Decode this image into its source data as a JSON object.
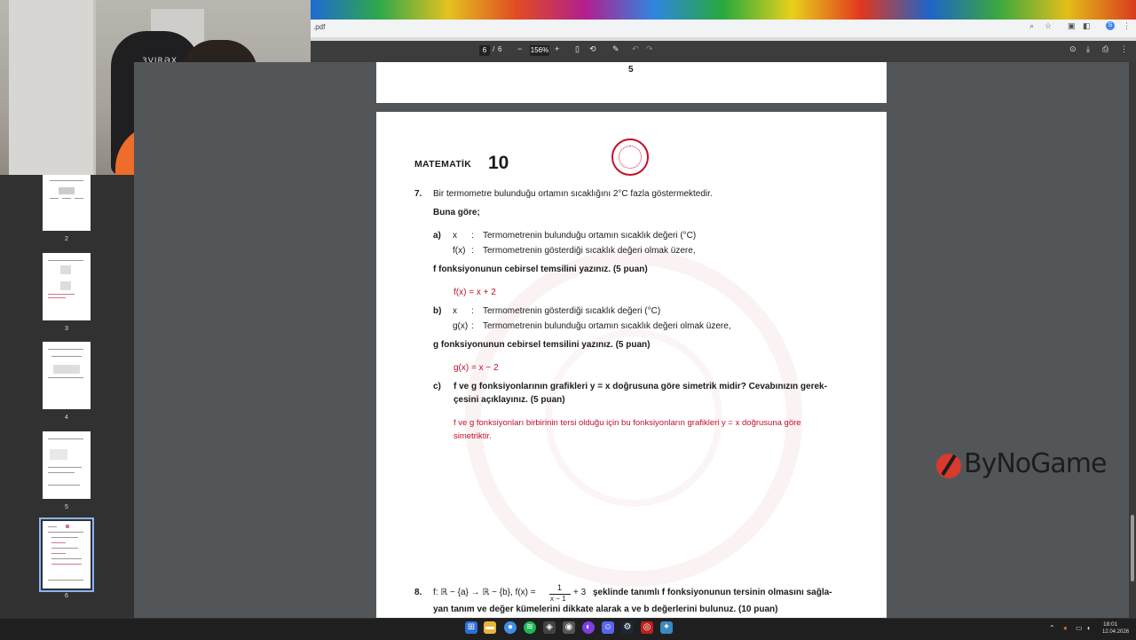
{
  "browser": {
    "url_fragment": ".pdf"
  },
  "pdf_toolbar": {
    "page_current": "6",
    "page_separator": "/",
    "page_total": "6",
    "zoom": "156%",
    "zoom_minus": "−",
    "zoom_plus": "+"
  },
  "sidebar": {
    "thumbnails": [
      {
        "label": "2"
      },
      {
        "label": "3"
      },
      {
        "label": "4"
      },
      {
        "label": "5"
      },
      {
        "label": "6"
      }
    ]
  },
  "page5": {
    "page_number": "5"
  },
  "page6": {
    "subject": "MATEMATİK",
    "grade": "10",
    "q7": {
      "number": "7.",
      "intro": "Bir termometre bulunduğu ortamın sıcaklığını 2°C fazla göstermektedir.",
      "buna_gore": "Buna göre;",
      "a_label": "a)",
      "a_x": "x",
      "a_colon1": ":",
      "a_x_desc": "Termometrenin bulunduğu ortamın sıcaklık değeri (°C)",
      "a_fx": "f(x)",
      "a_colon2": ":",
      "a_fx_desc": "Termometrenin gösterdiği sıcaklık değeri olmak üzere,",
      "a_task": "f fonksiyonunun cebirsel temsilini yazınız. (5 puan)",
      "a_answer": "f(x) = x + 2",
      "b_label": "b)",
      "b_x": "x",
      "b_colon1": ":",
      "b_x_desc": "Termometrenin gösterdiği sıcaklık değeri (°C)",
      "b_gx": "g(x)",
      "b_colon2": ":",
      "b_gx_desc": "Termometrenin bulunduğu ortamın sıcaklık değeri olmak üzere,",
      "b_task": "g fonksiyonunun cebirsel temsilini yazınız. (5 puan)",
      "b_answer": "g(x) = x − 2",
      "c_label": "c)",
      "c_task_line1": "f ve g fonksiyonlarının grafikleri y = x  doğrusuna göre simetrik midir? Cevabınızın gerek-",
      "c_task_line2": "çesini açıklayınız. (5 puan)",
      "c_answer_line1": "f ve g fonksiyonları birbirinin tersi olduğu için bu fonksiyonların grafikleri y = x doğrusuna göre",
      "c_answer_line2": "simetriktir."
    },
    "q8": {
      "number": "8.",
      "formula_prefix": "f: ℝ − {a} → ℝ − {b},  f(x) =",
      "frac_num": "1",
      "frac_den": "x − 1",
      "formula_suffix": "+ 3",
      "text_line1": "şeklinde tanımlı f fonksiyonunun tersinin olmasını sağla-",
      "text_line2": "yan tanım ve değer kümelerini dikkate alarak a ve b değerlerini bulunuz. (10 puan)"
    }
  },
  "overlay": {
    "brand": "ByNoGame"
  },
  "webcam": {
    "chair_label": "3VIRƏX"
  },
  "taskbar": {
    "clock_time": "18:01",
    "clock_date": "12.04.2026"
  }
}
